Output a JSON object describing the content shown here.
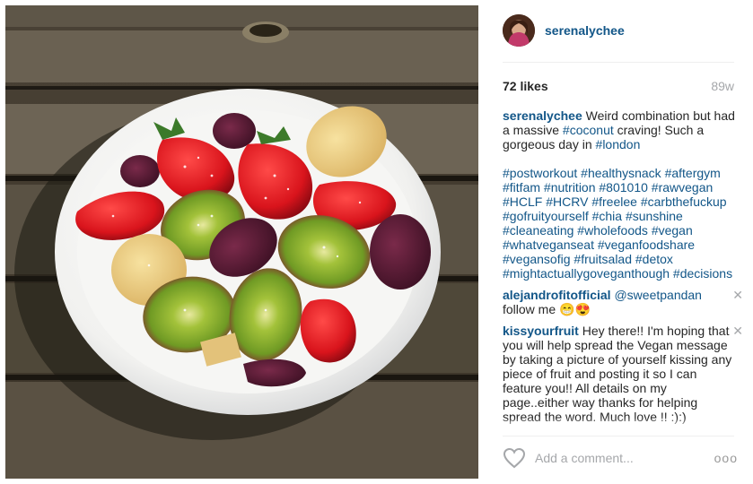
{
  "post": {
    "author": "serenalychee",
    "likes": "72 likes",
    "age": "89w"
  },
  "caption": {
    "user": "serenalychee",
    "text_before": " Weird combination but had a massive ",
    "tag1": "#coconut",
    "text_mid": " craving! Such a gorgeous day in ",
    "tag2": "#london",
    "hashtags": [
      "#postworkout",
      "#healthysnack",
      "#aftergym",
      "#fitfam",
      "#nutrition",
      "#801010",
      "#rawvegan",
      "#HCLF",
      "#HCRV",
      "#freelee",
      "#carbthefuckup",
      "#gofruityourself",
      "#chia",
      "#sunshine",
      "#cleaneating",
      "#wholefoods",
      "#vegan",
      "#whatveganseat",
      "#veganfoodshare",
      "#vegansofig",
      "#fruitsalad",
      "#detox",
      "#mightactuallygoveganthough",
      "#decisions"
    ]
  },
  "comments": [
    {
      "user": "alejandrofitofficial",
      "mention": "@sweetpandan",
      "text": "follow me 😁😍",
      "close": "✕"
    },
    {
      "user": "kissyourfruit",
      "text": " Hey there!! I'm hoping that you will help spread the Vegan message by taking a picture of yourself kissing any piece of fruit and posting it so I can feature you!! All details on my page..either way thanks for helping spread the word. Much love !! :):)",
      "close": "✕"
    }
  ],
  "footer": {
    "placeholder": "Add a comment...",
    "more": "ooo"
  },
  "colors": {
    "link": "#125688",
    "muted": "#a5a7aa",
    "text": "#262626"
  },
  "icons": {
    "like": "heart-icon",
    "more": "ellipsis-icon",
    "close": "close-icon"
  }
}
